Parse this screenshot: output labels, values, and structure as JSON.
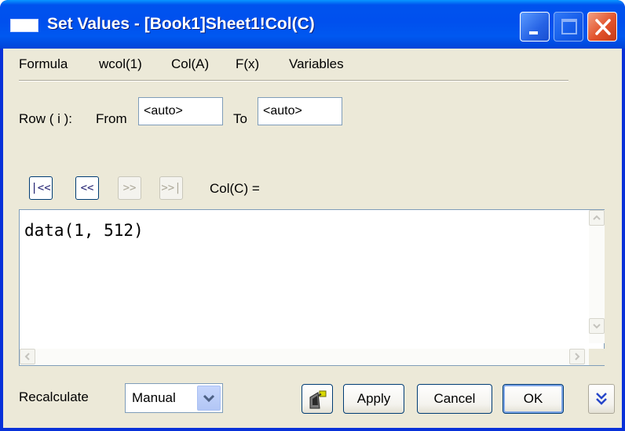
{
  "window": {
    "title": "Set Values - [Book1]Sheet1!Col(C)"
  },
  "menu": {
    "items": [
      {
        "label": "Formula"
      },
      {
        "label": "wcol(1)"
      },
      {
        "label": "Col(A)"
      },
      {
        "label": "F(x)"
      },
      {
        "label": "Variables"
      }
    ]
  },
  "row_range": {
    "label": "Row ( i ):",
    "from_label": "From",
    "from_value": "<auto>",
    "to_label": "To",
    "to_value": "<auto>"
  },
  "navigation": {
    "first_label": "|<<",
    "prev_label": "<<",
    "next_label": ">>",
    "last_label": ">>|",
    "target_label": "Col(C) ="
  },
  "formula": {
    "text": "data(1, 512)"
  },
  "footer": {
    "recalculate_label": "Recalculate",
    "recalculate_value": "Manual",
    "apply_label": "Apply",
    "cancel_label": "Cancel",
    "ok_label": "OK"
  },
  "icons": {
    "close": "close-icon",
    "minimize": "minimize-icon",
    "maximize": "maximize-icon",
    "dropdown": "chevron-down-icon",
    "expand": "double-chevron-down-icon",
    "formula_tool": "formula-tool-icon"
  },
  "colors": {
    "titlebar": "#0050ee",
    "dialog_background": "#ece9d8",
    "close_button": "#e2532c",
    "button_border": "#003c74"
  }
}
